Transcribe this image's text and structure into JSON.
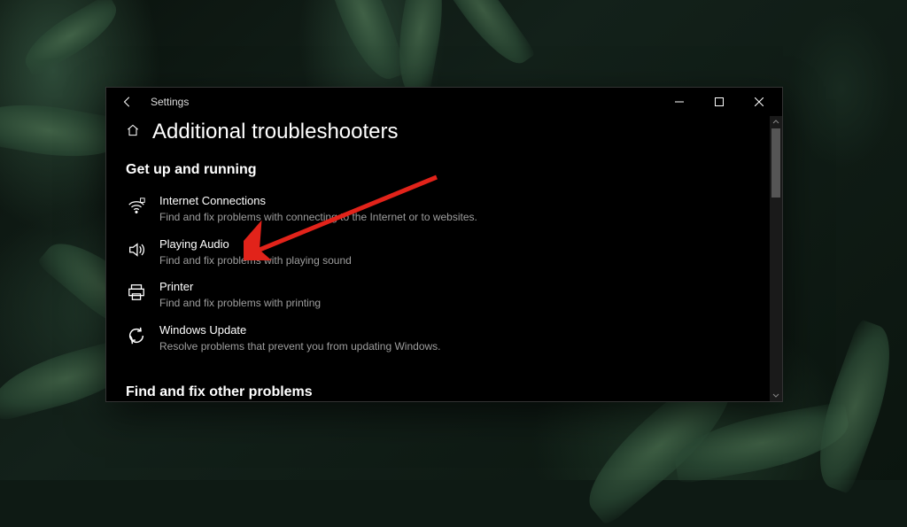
{
  "window": {
    "app_title": "Settings",
    "page_title": "Additional troubleshooters"
  },
  "sections": {
    "getup": {
      "title": "Get up and running",
      "items": [
        {
          "title": "Internet Connections",
          "desc": "Find and fix problems with connecting to the Internet or to websites."
        },
        {
          "title": "Playing Audio",
          "desc": "Find and fix problems with playing sound"
        },
        {
          "title": "Printer",
          "desc": "Find and fix problems with printing"
        },
        {
          "title": "Windows Update",
          "desc": "Resolve problems that prevent you from updating Windows."
        }
      ]
    },
    "other": {
      "title": "Find and fix other problems"
    }
  }
}
